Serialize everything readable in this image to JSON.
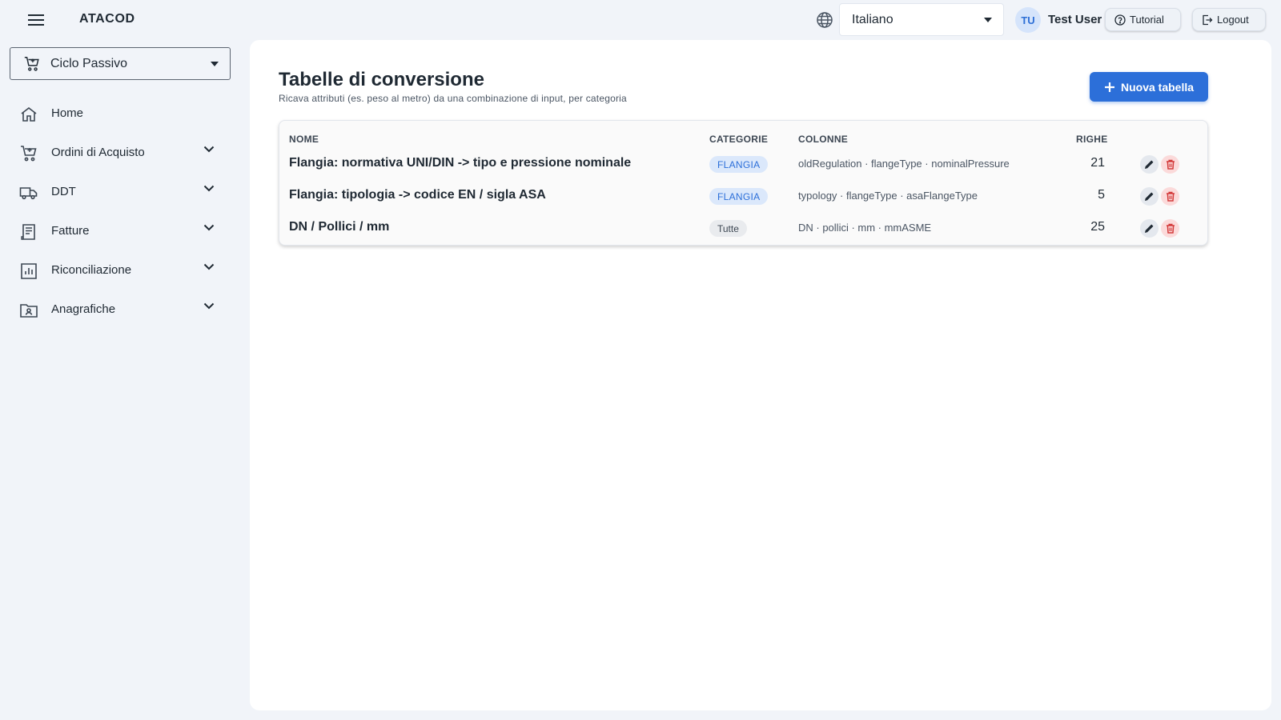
{
  "header": {
    "brand": "ATACOD",
    "language": {
      "selected": "Italiano"
    },
    "user": {
      "initials": "TU",
      "name": "Test User"
    },
    "tutorial_label": "Tutorial",
    "logout_label": "Logout"
  },
  "sidebar": {
    "module": "Ciclo Passivo",
    "items": [
      {
        "label": "Home",
        "icon": "home-icon",
        "expandable": false
      },
      {
        "label": "Ordini di Acquisto",
        "icon": "cart-icon",
        "expandable": true
      },
      {
        "label": "DDT",
        "icon": "truck-icon",
        "expandable": true
      },
      {
        "label": "Fatture",
        "icon": "receipt-icon",
        "expandable": true
      },
      {
        "label": "Riconciliazione",
        "icon": "chart-icon",
        "expandable": true
      },
      {
        "label": "Anagrafiche",
        "icon": "contact-folder-icon",
        "expandable": true
      }
    ]
  },
  "main": {
    "title": "Tabelle di conversione",
    "subtitle": "Ricava attributi (es. peso al metro) da una combinazione di input, per categoria",
    "new_button_label": "Nuova tabella",
    "table": {
      "headers": {
        "name": "NOME",
        "categories": "CATEGORIE",
        "columns": "COLONNE",
        "rows": "RIGHE"
      },
      "rows": [
        {
          "name": "Flangia: normativa UNI/DIN -> tipo e pressione nominale",
          "category": "FLANGIA",
          "columns": "oldRegulation · flangeType · nominalPressure",
          "rows": "21"
        },
        {
          "name": "Flangia: tipologia -> codice EN / sigla ASA",
          "category": "FLANGIA",
          "columns": "typology · flangeType · asaFlangeType",
          "rows": "5"
        },
        {
          "name": "DN / Pollici / mm",
          "category": "Tutte",
          "columns": "DN · pollici · mm · mmASME",
          "rows": "25"
        }
      ]
    }
  },
  "colors": {
    "accent": "#2c6fd9",
    "background": "#f1f4f9",
    "chip_blue_bg": "#dbe8fb",
    "delete_bg": "#fbdada",
    "delete_icon": "#d33a3a"
  }
}
